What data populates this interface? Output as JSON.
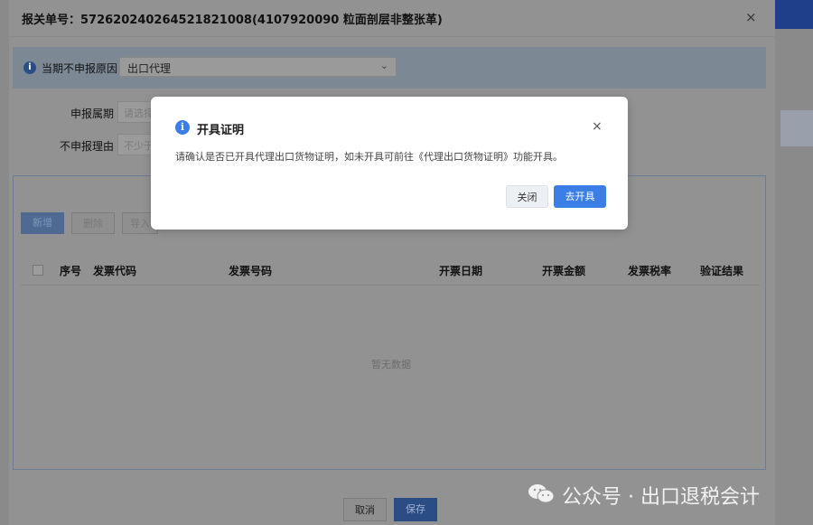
{
  "dialog": {
    "title": "报关单号：5726202402645218210​08(4107920090 粒面剖层非整张革)",
    "close_glyph": "×"
  },
  "reason": {
    "label": "当期不申报原因",
    "selected": "出口代理",
    "info_glyph": "i"
  },
  "form": {
    "period_label": "申报属期",
    "period_placeholder": "请选择",
    "reason_label": "不申报理由",
    "reason_placeholder": "不少于"
  },
  "toolbar": {
    "add_label": "新增",
    "delete_label": "删除",
    "import_label": "导入"
  },
  "table": {
    "columns": [
      "序号",
      "发票代码",
      "发票号码",
      "开票日期",
      "开票金额",
      "发票税率",
      "验证结果"
    ],
    "empty_text": "暂无数据"
  },
  "footer": {
    "cancel_label": "取消",
    "save_label": "保存"
  },
  "modal": {
    "title": "开具证明",
    "message": "请确认是否已开具代理出口货物证明，如未开具可前往《代理出口货物证明》功能开具。",
    "close_label": "关闭",
    "issue_label": "去开具",
    "close_glyph": "×",
    "info_glyph": "i"
  },
  "watermark": {
    "text": "公众号 · 出口退税会计"
  },
  "colors": {
    "accent": "#3a7ee6",
    "overlay": "#929292",
    "header_blue": "#1e3f8a"
  }
}
